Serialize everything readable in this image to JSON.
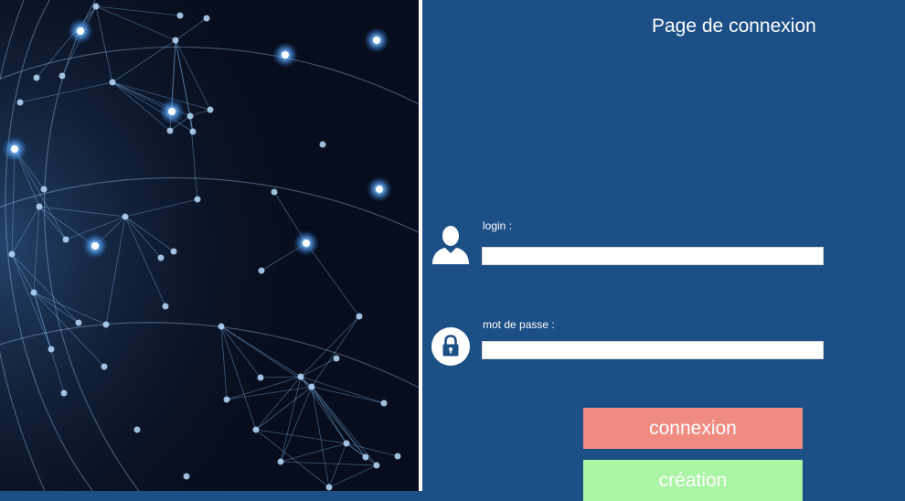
{
  "page": {
    "title": "Page de connexion"
  },
  "login": {
    "label": "login :",
    "value": "",
    "placeholder": ""
  },
  "password": {
    "label": "mot de passe :",
    "value": "",
    "placeholder": ""
  },
  "buttons": {
    "connexion": "connexion",
    "creation": "création"
  },
  "colors": {
    "panel_bg": "#1d4f87",
    "connexion_bg": "#f08b82",
    "creation_bg": "#a9f5a4"
  },
  "icons": {
    "login": "user-icon",
    "password": "lock-icon"
  }
}
